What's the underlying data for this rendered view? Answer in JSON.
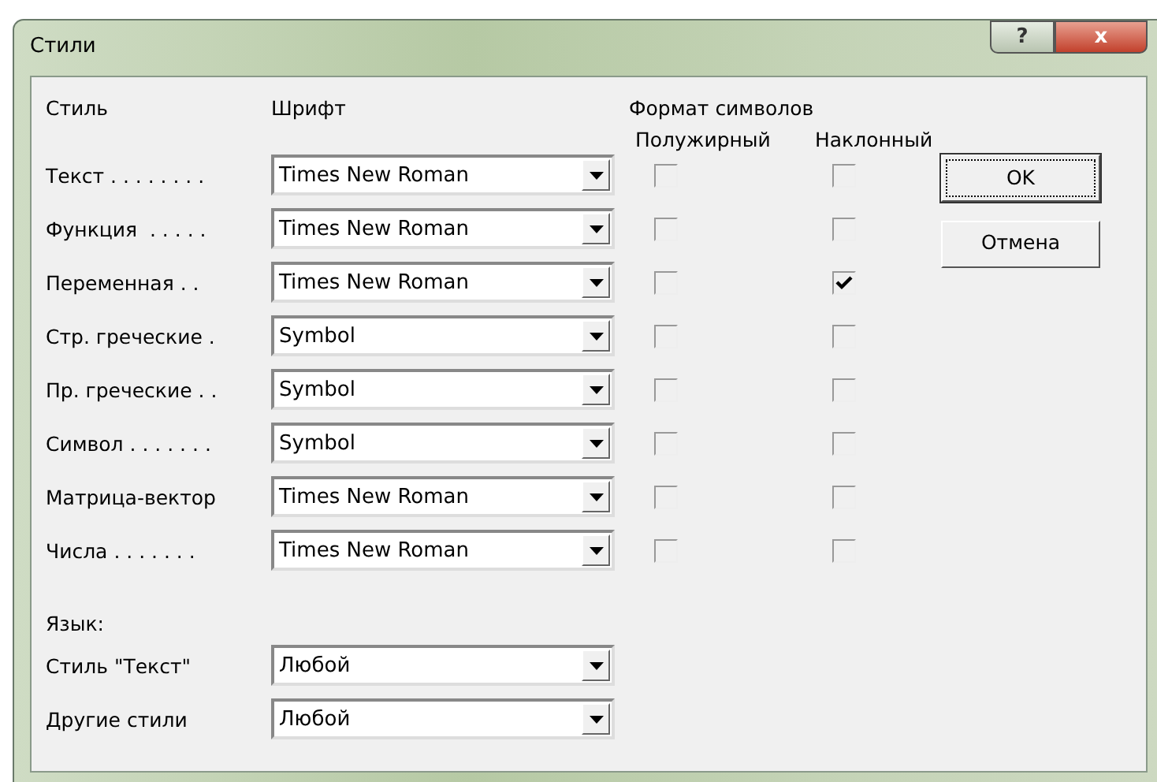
{
  "window": {
    "title": "Стили",
    "help_button": "?",
    "close_button": "x"
  },
  "headers": {
    "style": "Стиль",
    "font": "Шрифт",
    "format": "Формат символов",
    "bold": "Полужирный",
    "italic": "Наклонный"
  },
  "styles": [
    {
      "name": "Текст . . . . . . . .",
      "font": "Times New Roman",
      "bold": false,
      "italic": false
    },
    {
      "name": "Функция  . . . . .",
      "font": "Times New Roman",
      "bold": false,
      "italic": false
    },
    {
      "name": "Переменная . .",
      "font": "Times New Roman",
      "bold": false,
      "italic": true
    },
    {
      "name": "Стр. греческие .",
      "font": "Symbol",
      "bold": false,
      "italic": false
    },
    {
      "name": "Пр. греческие . .",
      "font": "Symbol",
      "bold": false,
      "italic": false
    },
    {
      "name": "Символ . . . . . . .",
      "font": "Symbol",
      "bold": false,
      "italic": false
    },
    {
      "name": "Матрица-вектор",
      "font": "Times New Roman",
      "bold": false,
      "italic": false
    },
    {
      "name": "Числа . . . . . . .",
      "font": "Times New Roman",
      "bold": false,
      "italic": false
    }
  ],
  "language": {
    "label": "Язык:",
    "rows": [
      {
        "name": "Стиль \"Текст\"",
        "value": "Любой"
      },
      {
        "name": "Другие стили",
        "value": "Любой"
      }
    ]
  },
  "buttons": [
    {
      "label": "OK",
      "default": true
    },
    {
      "label": "Отмена",
      "default": false
    }
  ]
}
